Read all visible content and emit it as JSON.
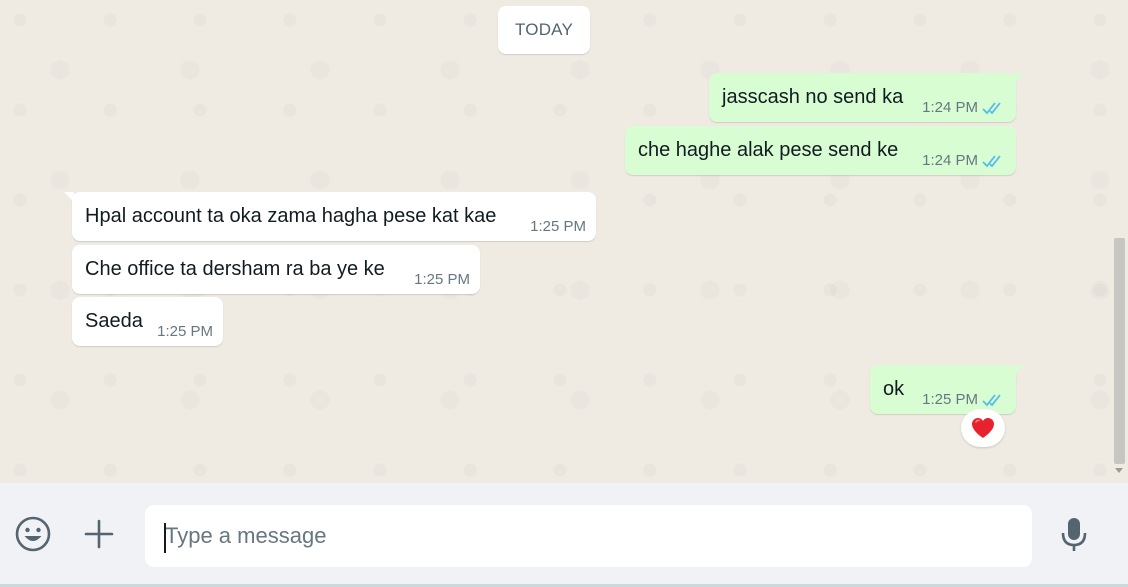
{
  "chat": {
    "date_divider": "TODAY",
    "messages": [
      {
        "direction": "out",
        "text": "jasscash no send ka",
        "time": "1:24 PM",
        "status": "read"
      },
      {
        "direction": "out",
        "text": "che haghe alak pese send ke",
        "time": "1:24 PM",
        "status": "read"
      },
      {
        "direction": "in",
        "text": "Hpal account ta oka zama hagha pese kat kae",
        "time": "1:25 PM"
      },
      {
        "direction": "in",
        "text": "Che office ta dersham ra ba ye ke",
        "time": "1:25 PM"
      },
      {
        "direction": "in",
        "text": "Saeda",
        "time": "1:25 PM"
      },
      {
        "direction": "out",
        "text": "ok",
        "time": "1:25 PM",
        "status": "read",
        "reaction": "red-heart"
      }
    ]
  },
  "composer": {
    "placeholder": "Type a message",
    "emoji_icon": "emoji-icon",
    "attach_icon": "plus-icon",
    "mic_icon": "microphone-icon"
  },
  "colors": {
    "outgoing_bubble": "#d9fdd3",
    "incoming_bubble": "#ffffff",
    "chat_background": "#efeae2",
    "read_ticks": "#53bdeb",
    "footer_background": "#f0f2f5"
  }
}
